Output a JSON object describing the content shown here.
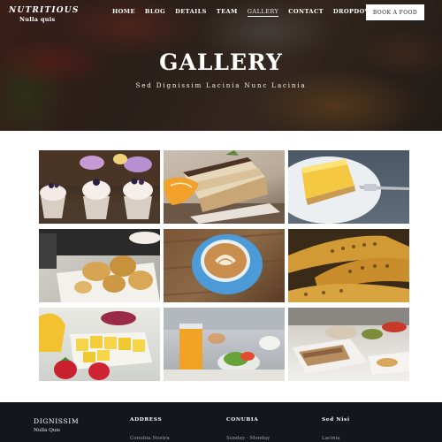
{
  "brand": {
    "name": "NUTRITIOUS",
    "tagline": "Nulla quis"
  },
  "nav": {
    "items": [
      {
        "label": "HOME"
      },
      {
        "label": "BLOG"
      },
      {
        "label": "DETAILS"
      },
      {
        "label": "TEAM"
      },
      {
        "label": "GALLERY"
      },
      {
        "label": "CONTACT"
      },
      {
        "label": "DROPDOWN"
      }
    ],
    "active": "GALLERY",
    "dropdown_icon": "chevron-down-icon",
    "book_button": "BOOK A FOOD"
  },
  "hero": {
    "title": "GALLERY",
    "subtitle": "Sed Dignissim Lacinia Nunc Lacinia"
  },
  "gallery": {
    "images": [
      {
        "subject": "cupcakes"
      },
      {
        "subject": "tiramisu-cake"
      },
      {
        "subject": "lemon-cheesecake"
      },
      {
        "subject": "fried-pastries"
      },
      {
        "subject": "latte-art-coffee"
      },
      {
        "subject": "grilled-corn"
      },
      {
        "subject": "fruit-plate"
      },
      {
        "subject": "brunch-table"
      },
      {
        "subject": "snack-platter"
      }
    ]
  },
  "footer": {
    "brand": {
      "name": "DIGNISSIM",
      "tagline": "Nulla Quis"
    },
    "columns": [
      {
        "heading": "ADDRESS",
        "first_item": "Conubia Nostra"
      },
      {
        "heading": "CONUBIA",
        "first_item": "Sunday - Monday"
      },
      {
        "heading": "Sed Nisi",
        "first_item": "Lacinia"
      }
    ]
  },
  "colors": {
    "footer_bg": "#14161c",
    "button_bg": "#ffffff",
    "footer_muted": "#9aa0aa"
  }
}
